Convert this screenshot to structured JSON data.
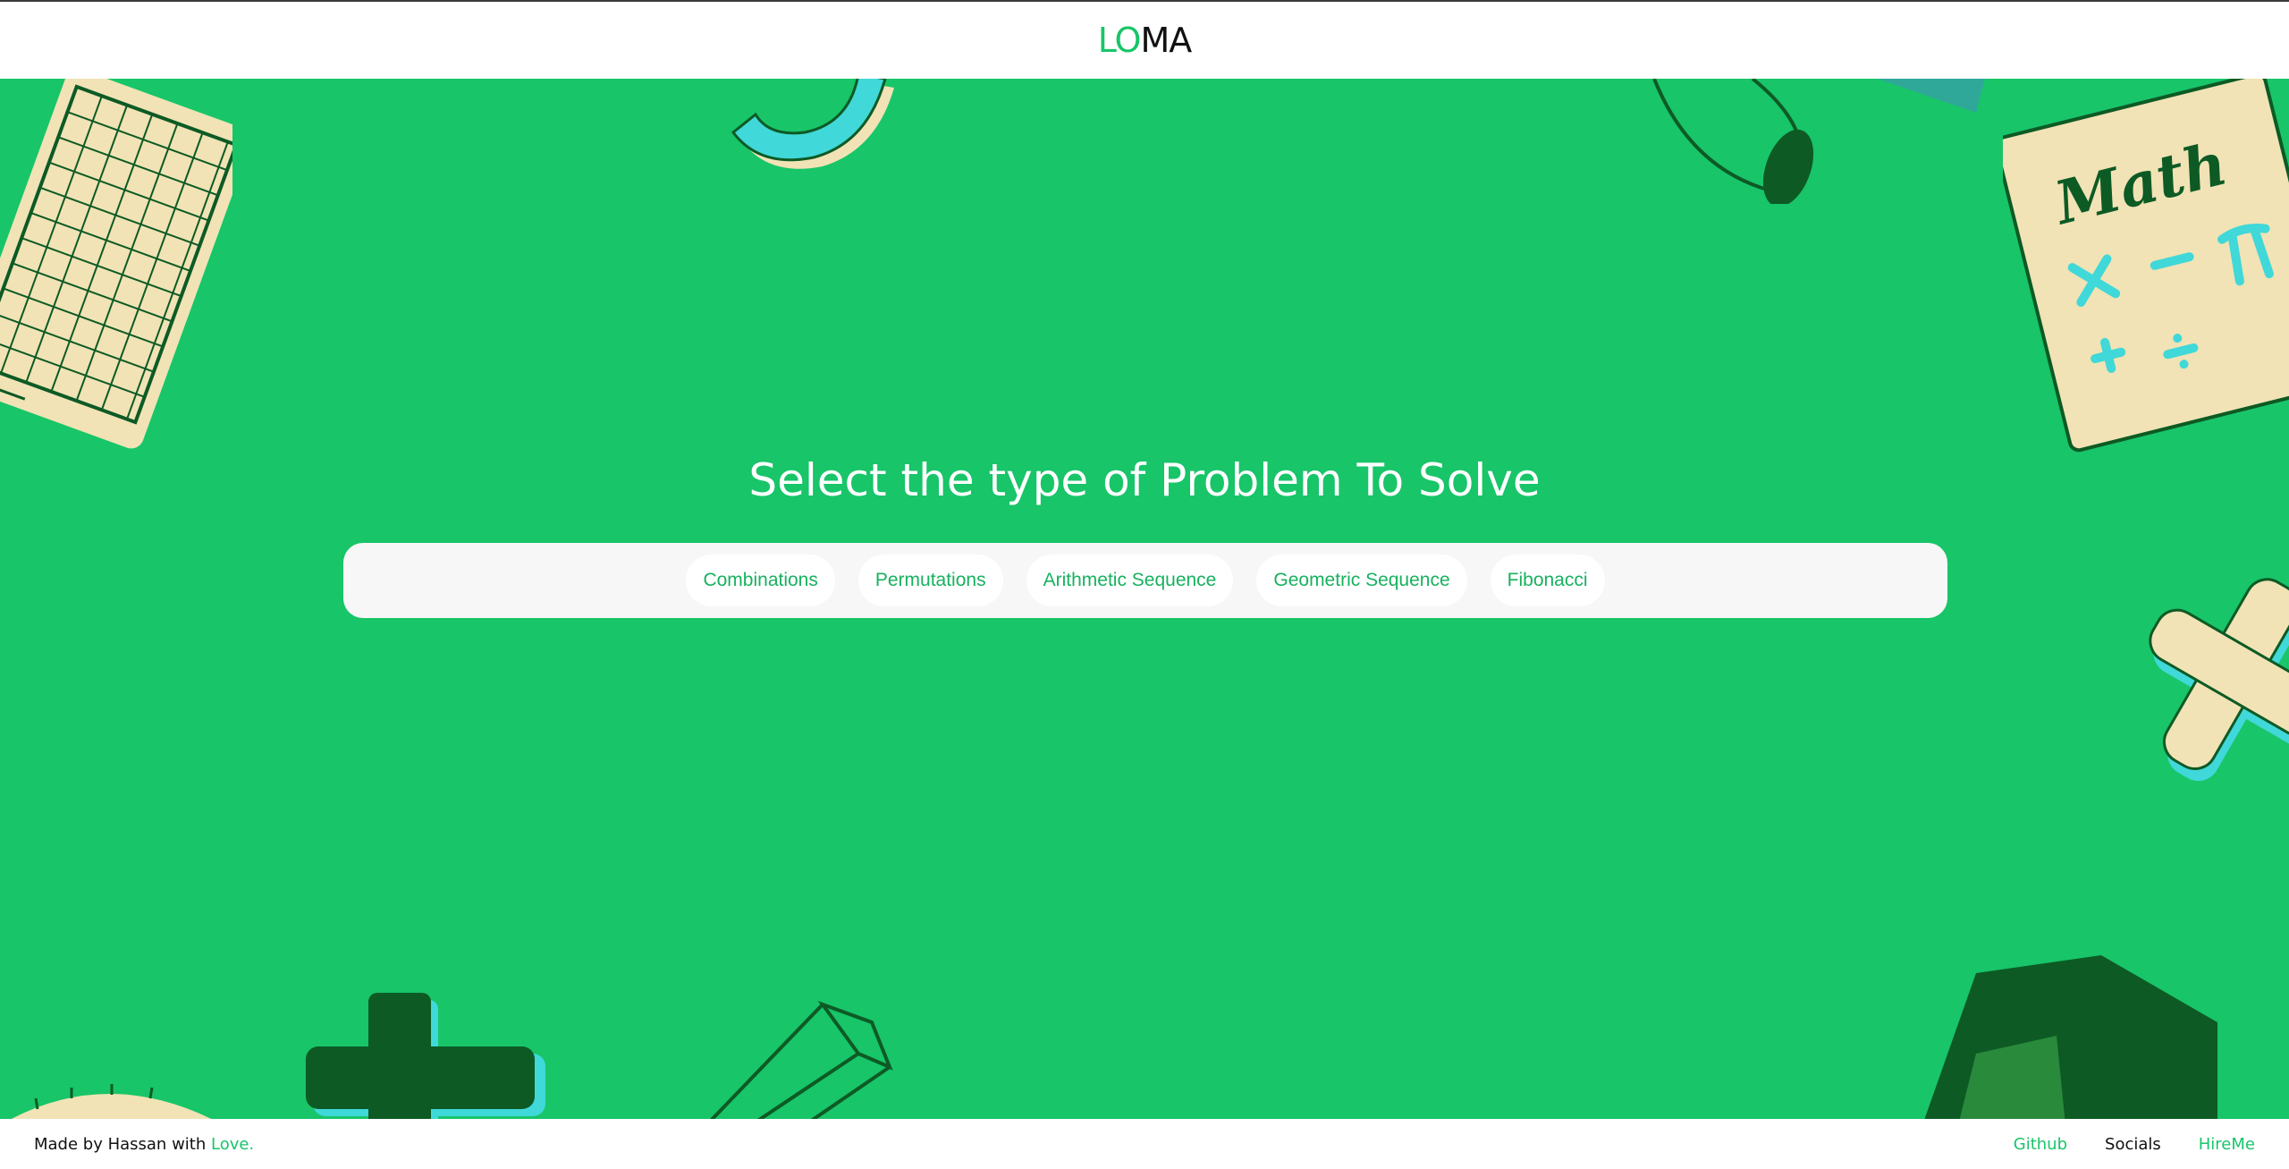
{
  "header": {
    "logo_part1": "LO",
    "logo_part2": "MA"
  },
  "main": {
    "title": "Select the type of Problem To Solve",
    "problem_types": [
      "Combinations",
      "Permutations",
      "Arithmetic Sequence",
      "Geometric Sequence",
      "Fibonacci"
    ],
    "decorations": {
      "book_text": "Math"
    }
  },
  "footer": {
    "text_prefix": "Made by Hassan with ",
    "love": "Love.",
    "links": {
      "github": "Github",
      "socials": "Socials",
      "hireme": "HireMe"
    }
  },
  "colors": {
    "brand_green": "#18c569",
    "dark_green": "#0d5a25",
    "cream": "#f1e3b5",
    "cyan": "#40d8d8",
    "selector_bg": "#f7f7f7"
  }
}
